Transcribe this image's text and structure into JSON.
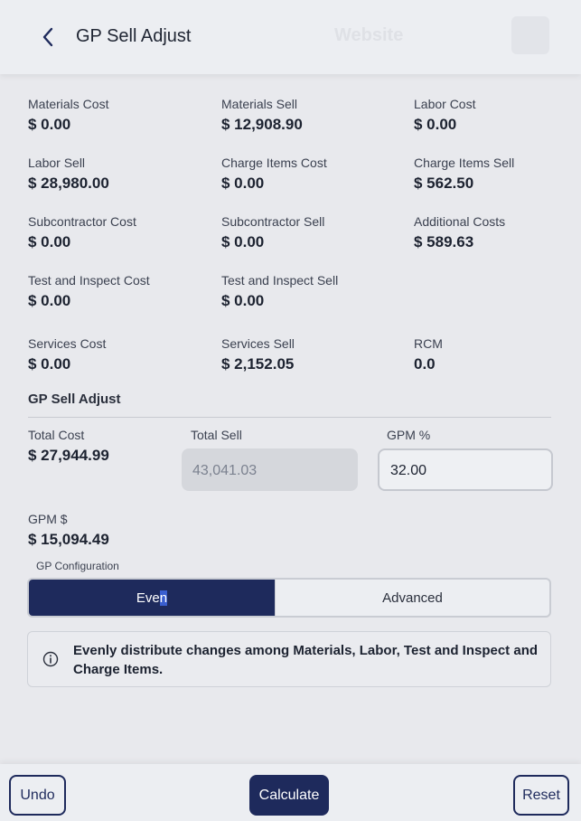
{
  "header": {
    "title": "GP Sell Adjust",
    "bg_text": "Website"
  },
  "summary": [
    {
      "label": "Materials Cost",
      "value": "$ 0.00"
    },
    {
      "label": "Materials Sell",
      "value": "$ 12,908.90"
    },
    {
      "label": "Labor Cost",
      "value": "$ 0.00"
    },
    {
      "label": "Labor Sell",
      "value": "$ 28,980.00"
    },
    {
      "label": "Charge Items Cost",
      "value": "$ 0.00"
    },
    {
      "label": "Charge Items Sell",
      "value": "$ 562.50"
    },
    {
      "label": "Subcontractor Cost",
      "value": "$ 0.00"
    },
    {
      "label": "Subcontractor Sell",
      "value": "$ 0.00"
    },
    {
      "label": "Additional Costs",
      "value": "$ 589.63"
    },
    {
      "label": "Test and Inspect Cost",
      "value": "$ 0.00"
    },
    {
      "label": "Test and Inspect Sell",
      "value": "$ 0.00"
    },
    {
      "label": "Services Cost",
      "value": "$ 0.00"
    },
    {
      "label": "Services Sell",
      "value": "$ 2,152.05"
    },
    {
      "label": "RCM",
      "value": "0.0"
    }
  ],
  "adjust": {
    "section_title": "GP Sell Adjust",
    "total_cost_label": "Total Cost",
    "total_cost_value": "$ 27,944.99",
    "total_sell_label": "Total Sell",
    "total_sell_value": "43,041.03",
    "gpm_pct_label": "GPM %",
    "gpm_pct_value": "32.00",
    "gpm_dollar_label": "GPM $",
    "gpm_dollar_value": "$ 15,094.49"
  },
  "config": {
    "label": "GP Configuration",
    "option_even_a": "Eve",
    "option_even_b": "n",
    "option_advanced": "Advanced",
    "selected": "Even"
  },
  "info": {
    "icon": "info-icon",
    "text": "Evenly distribute changes among Materials, Labor, Test and Inspect and Charge Items."
  },
  "footer": {
    "undo": "Undo",
    "calculate": "Calculate",
    "reset": "Reset"
  },
  "colors": {
    "primary": "#1e2a5c",
    "background": "#e8e9ed",
    "disabled_field": "#d5d7dc"
  }
}
